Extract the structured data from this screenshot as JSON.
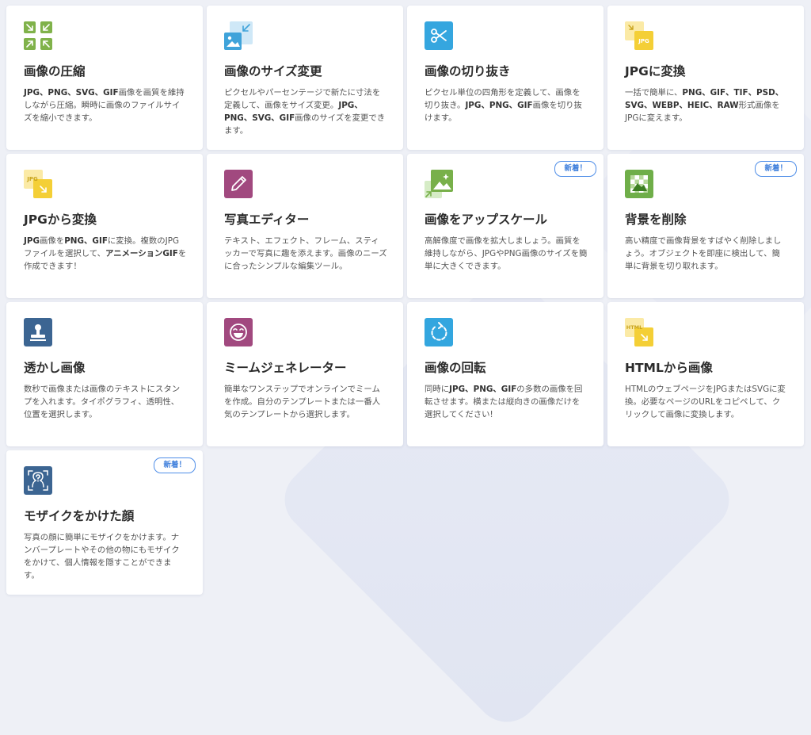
{
  "tools": [
    {
      "icon": "compress-icon",
      "title": "画像の圧縮",
      "desc_parts": [
        {
          "t": "JPG、PNG、SVG、GIF",
          "b": true
        },
        {
          "t": "画像を画質を維持しながら圧縮。瞬時に画像のファイルサイズを縮小できます。",
          "b": false
        }
      ]
    },
    {
      "icon": "resize-icon",
      "title": "画像のサイズ変更",
      "desc_parts": [
        {
          "t": "ピクセルやパーセンテージで新たに寸法を定義して、画像をサイズ変更。",
          "b": false
        },
        {
          "t": "JPG、PNG、SVG、GIF",
          "b": true
        },
        {
          "t": "画像のサイズを変更できます。",
          "b": false
        }
      ]
    },
    {
      "icon": "scissors-icon",
      "title": "画像の切り抜き",
      "desc_parts": [
        {
          "t": "ピクセル単位の四角形を定義して、画像を切り抜き。",
          "b": false
        },
        {
          "t": "JPG、PNG、GIF",
          "b": true
        },
        {
          "t": "画像を切り抜けます。",
          "b": false
        }
      ]
    },
    {
      "icon": "convert-to-jpg-icon",
      "title": "JPGに変換",
      "desc_parts": [
        {
          "t": "一括で簡単に、",
          "b": false
        },
        {
          "t": "PNG、GIF、TIF、PSD、SVG、WEBP、HEIC、RAW",
          "b": true
        },
        {
          "t": "形式画像をJPGに変えます。",
          "b": false
        }
      ]
    },
    {
      "icon": "convert-from-jpg-icon",
      "title": "JPGから変換",
      "desc_parts": [
        {
          "t": "JPG",
          "b": true
        },
        {
          "t": "画像を",
          "b": false
        },
        {
          "t": "PNG、GIF",
          "b": true
        },
        {
          "t": "に変換。複数のJPGファイルを選択して、",
          "b": false
        },
        {
          "t": "アニメーションGIF",
          "b": true
        },
        {
          "t": "を作成できます！",
          "b": false
        }
      ]
    },
    {
      "icon": "pencil-icon",
      "title": "写真エディター",
      "desc_parts": [
        {
          "t": "テキスト、エフェクト、フレーム、スティッカーで写真に趣を添えます。画像のニーズに合ったシンプルな編集ツール。",
          "b": false
        }
      ]
    },
    {
      "icon": "upscale-icon",
      "title": "画像をアップスケール",
      "badge": "新着！",
      "desc_parts": [
        {
          "t": "高解像度で画像を拡大しましょう。画質を維持しながら、JPGやPNG画像のサイズを簡単に大きくできます。",
          "b": false
        }
      ]
    },
    {
      "icon": "remove-background-icon",
      "title": "背景を削除",
      "badge": "新着！",
      "desc_parts": [
        {
          "t": "高い精度で画像背景をすばやく削除しましょう。オブジェクトを即座に検出して、簡単に背景を切り取れます。",
          "b": false
        }
      ]
    },
    {
      "icon": "stamp-icon",
      "title": "透かし画像",
      "desc_parts": [
        {
          "t": "数秒で画像または画像のテキストにスタンプを入れます。タイポグラフィ、透明性、位置を選択します。",
          "b": false
        }
      ]
    },
    {
      "icon": "laughing-face-icon",
      "title": "ミームジェネレーター",
      "desc_parts": [
        {
          "t": "簡単なワンステップでオンラインでミームを作成。自分のテンプレートまたは一番人気のテンプレートから選択します。",
          "b": false
        }
      ]
    },
    {
      "icon": "rotate-icon",
      "title": "画像の回転",
      "desc_parts": [
        {
          "t": "同時に",
          "b": false
        },
        {
          "t": "JPG、PNG、GIF",
          "b": true
        },
        {
          "t": "の多数の画像を回転させます。横または縦向きの画像だけを選択してください!",
          "b": false
        }
      ]
    },
    {
      "icon": "html-to-image-icon",
      "title": "HTMLから画像",
      "desc_parts": [
        {
          "t": "HTMLのウェブページをJPGまたはSVGに変換。必要なページのURLをコピペして、クリックして画像に変換します。",
          "b": false
        }
      ]
    },
    {
      "icon": "face-blur-icon",
      "title": "モザイクをかけた顔",
      "badge": "新着！",
      "desc_parts": [
        {
          "t": "写真の顔に簡単にモザイクをかけます。ナンバープレートやその他の物にもモザイクをかけて、個人情報を隠すことができます。",
          "b": false
        }
      ]
    }
  ],
  "colors": {
    "compress": "#80b24a",
    "resize": "#3fa3da",
    "crop": "#35a6df",
    "jpg": "#f4cf36",
    "editor": "#a1497f",
    "upscale": "#78b04a",
    "removebg": "#6fae49",
    "watermark": "#3c6592",
    "meme": "#a1497f",
    "rotate": "#33a6df",
    "html": "#f4cf36",
    "blur": "#3c6592",
    "badge": "#3f7fdc"
  }
}
